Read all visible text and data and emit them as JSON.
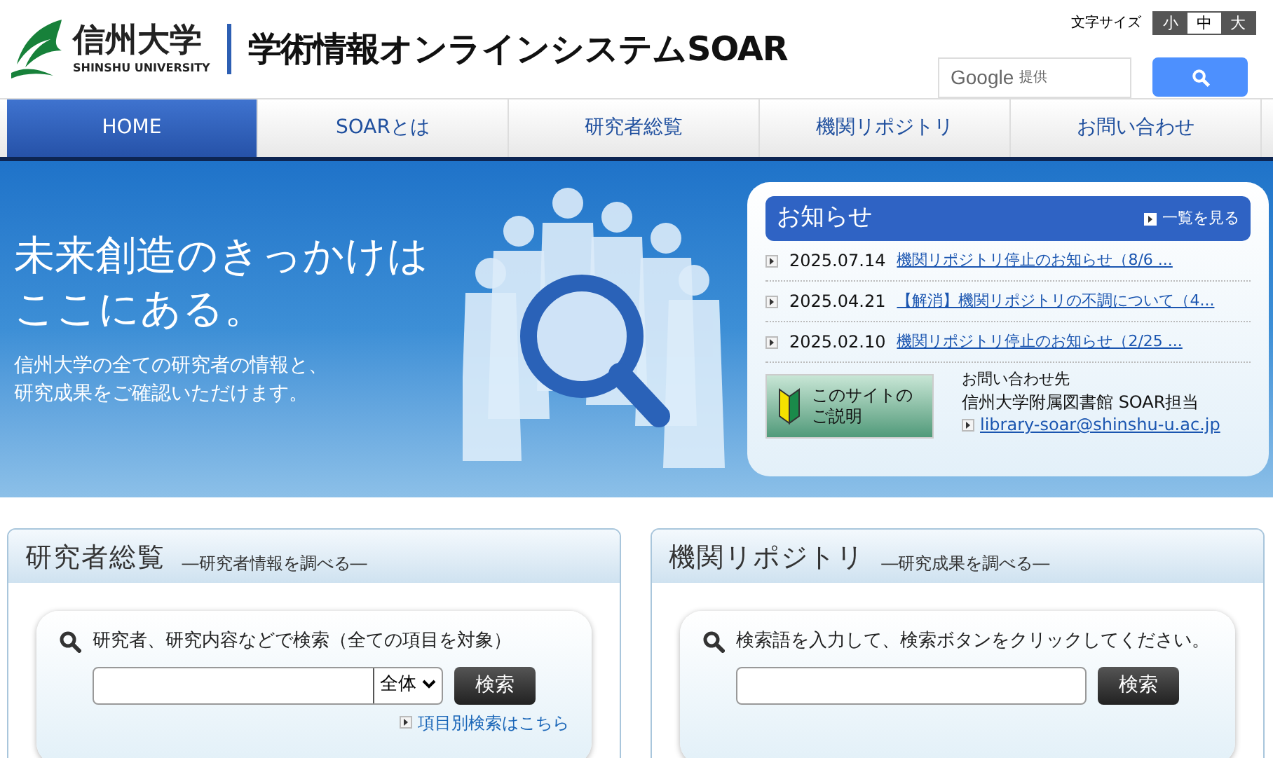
{
  "header": {
    "logo_name": "信州大学",
    "logo_sub": "SHINSHU UNIVERSITY",
    "title": "学術情報オンラインシステムSOAR",
    "font_size_label": "文字サイズ",
    "font_sizes": [
      {
        "label": "小",
        "selected": false
      },
      {
        "label": "中",
        "selected": true
      },
      {
        "label": "大",
        "selected": false
      }
    ],
    "search": {
      "brand": "Google",
      "brand_note": "提供"
    }
  },
  "nav": [
    {
      "label": "HOME",
      "selected": true
    },
    {
      "label": "SOARとは",
      "selected": false
    },
    {
      "label": "研究者総覧",
      "selected": false
    },
    {
      "label": "機関リポジトリ",
      "selected": false
    },
    {
      "label": "お問い合わせ",
      "selected": false
    }
  ],
  "hero": {
    "headline": [
      "未来創造のきっかけは",
      "ここにある。"
    ],
    "sub": [
      "信州大学の全ての研究者の情報と、",
      "研究成果をご確認いただけます。"
    ]
  },
  "news": {
    "title": "お知らせ",
    "more": "一覧を見る",
    "items": [
      {
        "date": "2025.07.14",
        "text": "機関リポジトリ停止のお知らせ（8/6 ..."
      },
      {
        "date": "2025.04.21",
        "text": "【解消】機関リポジトリの不調について（4..."
      },
      {
        "date": "2025.02.10",
        "text": "機関リポジトリ停止のお知らせ（2/25 ..."
      }
    ],
    "guide": [
      "このサイトの",
      "ご説明"
    ],
    "contact": {
      "label": "お問い合わせ先",
      "org": "信州大学附属図書館 SOAR担当",
      "email": "library-soar@shinshu-u.ac.jp"
    }
  },
  "panels": [
    {
      "title": "研究者総覧",
      "subtitle": "―研究者情報を調べる―",
      "prompt": "研究者、研究内容などで検索（全ての項目を対象）",
      "select": "全体",
      "button": "検索",
      "link": "項目別検索はこちら"
    },
    {
      "title": "機関リポジトリ",
      "subtitle": "―研究成果を調べる―",
      "prompt": "検索語を入力して、検索ボタンをクリックしてください。",
      "button": "検索"
    }
  ]
}
